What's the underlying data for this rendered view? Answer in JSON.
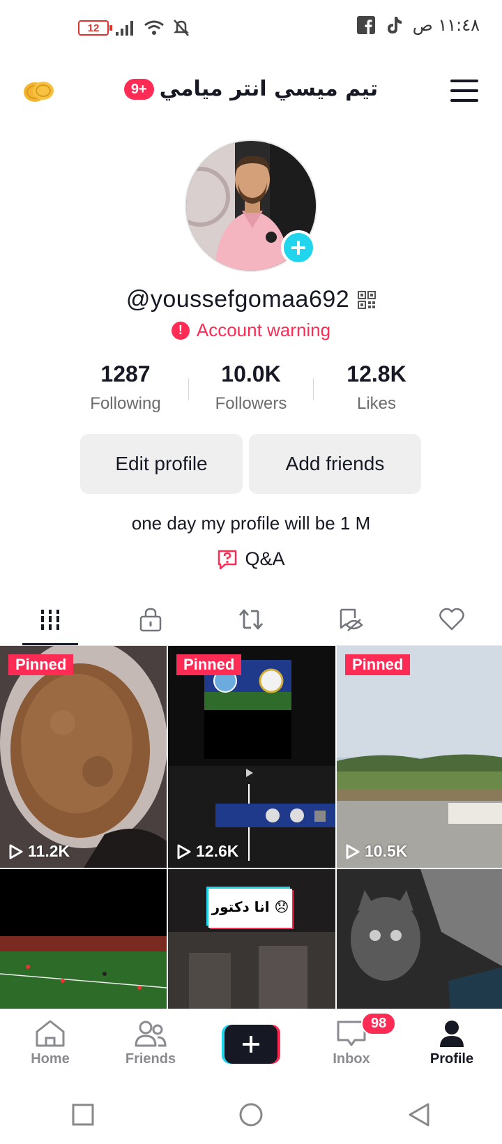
{
  "status_bar": {
    "battery": "12",
    "time": "١١:٤٨ ص",
    "icons": [
      "signal-icon",
      "wifi-icon",
      "mute-bell-icon",
      "facebook-icon",
      "tiktok-icon"
    ]
  },
  "header": {
    "title": "تيم ميسي انتر ميامي",
    "notification_badge": "9+",
    "coin_icon": "coins-icon",
    "menu_icon": "hamburger-menu-icon"
  },
  "profile": {
    "username": "@youssefgomaa692",
    "warning": "Account warning",
    "stats": [
      {
        "value": "1287",
        "label": "Following"
      },
      {
        "value": "10.0K",
        "label": "Followers"
      },
      {
        "value": "12.8K",
        "label": "Likes"
      }
    ],
    "edit_button": "Edit profile",
    "add_friends_button": "Add friends",
    "bio": "one day my profile will be 1 M",
    "qa_label": "Q&A"
  },
  "tabs": [
    {
      "icon": "grid-icon",
      "active": true
    },
    {
      "icon": "lock-icon",
      "active": false
    },
    {
      "icon": "repost-icon",
      "active": false
    },
    {
      "icon": "hidden-eye-icon",
      "active": false
    },
    {
      "icon": "heart-icon",
      "active": false
    }
  ],
  "videos": [
    {
      "pinned": "Pinned",
      "views": "11.2K",
      "thumb": "coffee"
    },
    {
      "pinned": "Pinned",
      "views": "12.6K",
      "thumb": "editor"
    },
    {
      "pinned": "Pinned",
      "views": "10.5K",
      "thumb": "field"
    },
    {
      "thumb": "football"
    },
    {
      "thumb": "doctor",
      "caption": "انا دكتور 😞"
    },
    {
      "thumb": "cat"
    }
  ],
  "bottom_nav": {
    "home": "Home",
    "friends": "Friends",
    "inbox": "Inbox",
    "inbox_badge": "98",
    "profile": "Profile"
  },
  "colors": {
    "accent": "#fe2c55",
    "cyan": "#20d5ec",
    "text": "#161823"
  }
}
